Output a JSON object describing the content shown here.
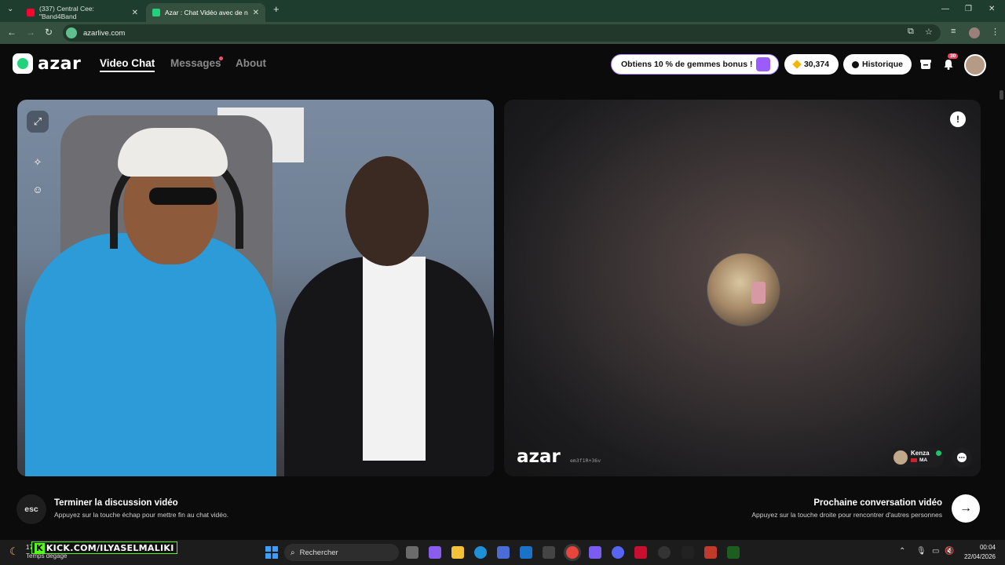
{
  "browser": {
    "tabs": [
      {
        "label": "(337) Central Cee: \"Band4Band",
        "favicon_color": "#ff0033"
      },
      {
        "label": "Azar : Chat Vidéo avec de n",
        "favicon_color": "#1fd37c"
      }
    ],
    "url": "azarlive.com"
  },
  "app": {
    "logo_text": "azar",
    "nav": {
      "video_chat": "Video Chat",
      "messages": "Messages",
      "about": "About"
    },
    "promo_label": "Obtiens 10 % de gemmes bonus !",
    "gems_count": "30,374",
    "history_label": "Historique",
    "notifications_badge": "30"
  },
  "remote": {
    "watermark": "azar",
    "watermark_code": "em3f1R+36v",
    "user_name": "Kenza",
    "user_country": "MA"
  },
  "controls": {
    "esc_label": "esc",
    "end_title": "Terminer la discussion vidéo",
    "end_subtitle": "Appuyez sur la touche échap pour mettre fin au chat vidéo.",
    "next_title": "Prochaine conversation vidéo",
    "next_subtitle": "Appuyez sur la touche droite pour rencontrer d'autres personnes"
  },
  "overlay": {
    "kick_text": "KICK.COM/ILYASELMALIKI"
  },
  "taskbar": {
    "weather_temp": "17",
    "weather_desc": "Temps dégagé",
    "search_placeholder": "Rechercher",
    "time": "00:04",
    "date": "22/04/2026"
  },
  "colors": {
    "accent": "#1fd37c",
    "chrome_bg": "#1f3d2e",
    "notif_red": "#ff3b5c"
  }
}
